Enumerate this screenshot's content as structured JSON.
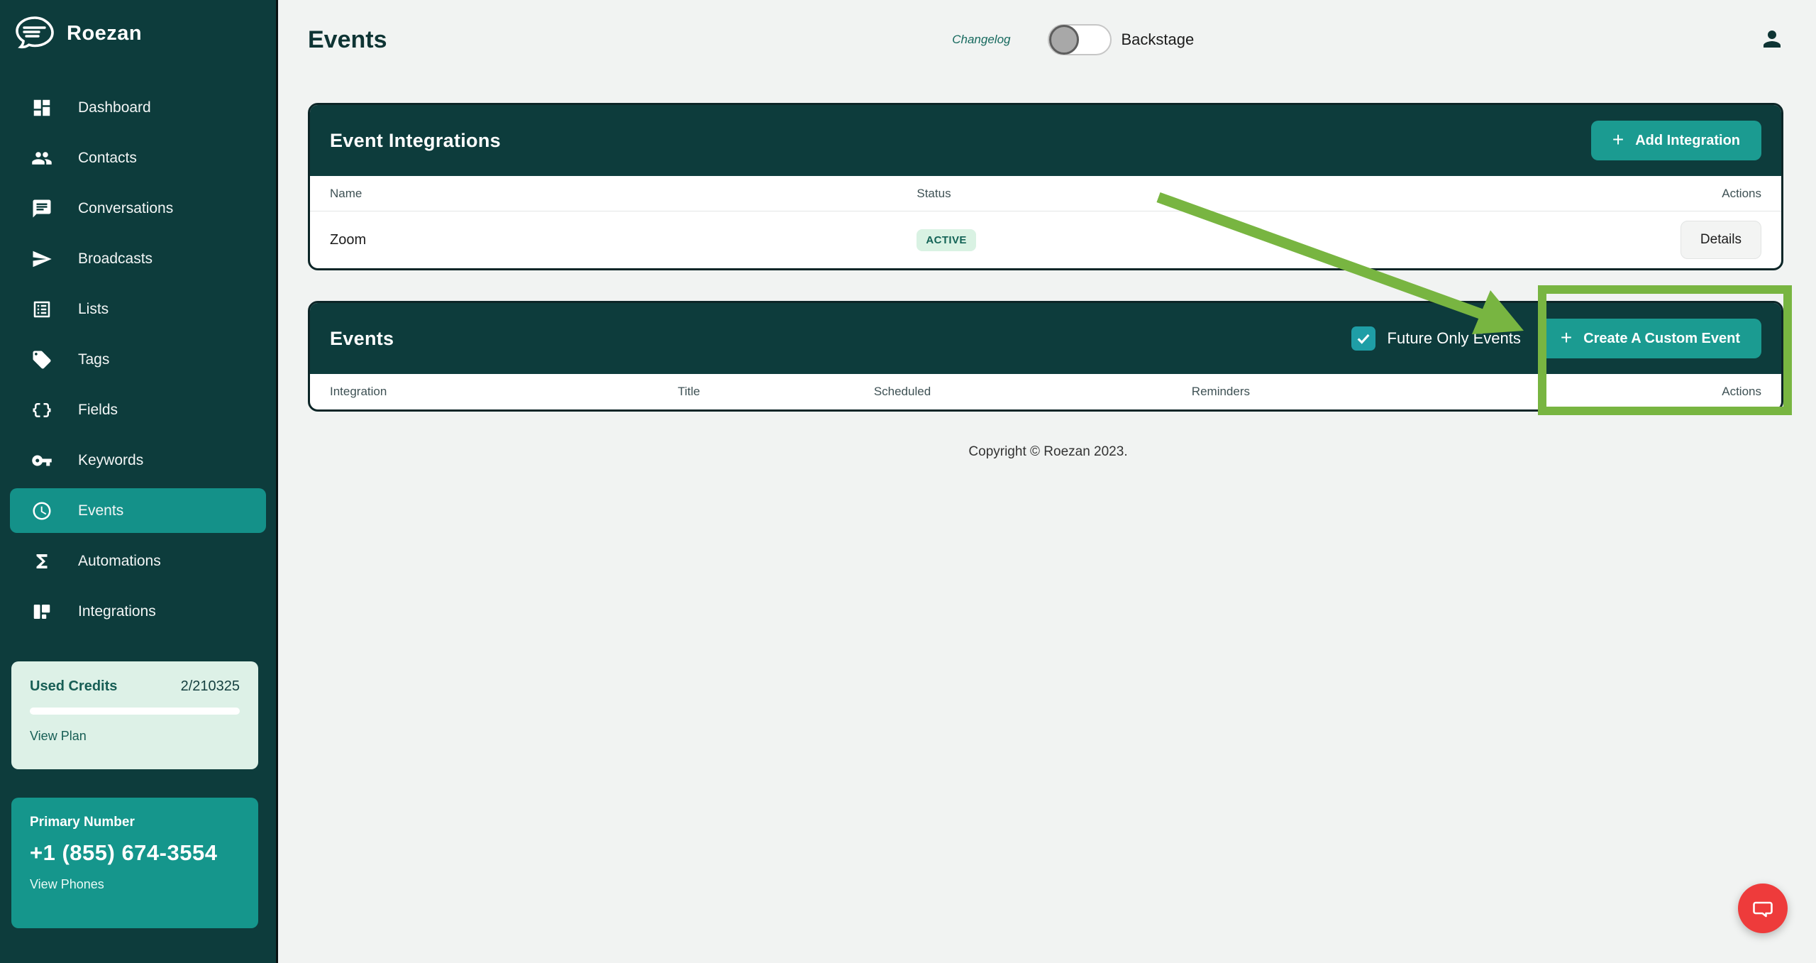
{
  "app": {
    "name": "Roezan"
  },
  "sidebar": {
    "items": [
      {
        "label": "Dashboard",
        "icon": "dashboard-icon",
        "active": false
      },
      {
        "label": "Contacts",
        "icon": "contacts-icon",
        "active": false
      },
      {
        "label": "Conversations",
        "icon": "conversations-icon",
        "active": false
      },
      {
        "label": "Broadcasts",
        "icon": "broadcasts-icon",
        "active": false
      },
      {
        "label": "Lists",
        "icon": "lists-icon",
        "active": false
      },
      {
        "label": "Tags",
        "icon": "tags-icon",
        "active": false
      },
      {
        "label": "Fields",
        "icon": "fields-icon",
        "active": false
      },
      {
        "label": "Keywords",
        "icon": "keywords-icon",
        "active": false
      },
      {
        "label": "Events",
        "icon": "events-clock-icon",
        "active": true
      },
      {
        "label": "Automations",
        "icon": "automations-icon",
        "active": false
      },
      {
        "label": "Integrations",
        "icon": "integrations-icon",
        "active": false
      }
    ],
    "credits": {
      "title": "Used Credits",
      "value": "2/210325",
      "link": "View Plan"
    },
    "phone": {
      "title": "Primary Number",
      "number": "+1 (855) 674-3554",
      "link": "View Phones"
    }
  },
  "header": {
    "title": "Events",
    "changelog_label": "Changelog",
    "toggle_label": "Backstage",
    "toggle_on": false
  },
  "integrations_panel": {
    "title": "Event Integrations",
    "add_button_label": "Add Integration",
    "columns": [
      "Name",
      "Status",
      "Actions"
    ],
    "rows": [
      {
        "name": "Zoom",
        "status": "ACTIVE",
        "action": "Details"
      }
    ]
  },
  "events_panel": {
    "title": "Events",
    "checkbox_label": "Future Only Events",
    "checkbox_checked": true,
    "create_button_label": "Create A Custom Event",
    "columns": [
      "Integration",
      "Title",
      "Scheduled",
      "Reminders",
      "Actions"
    ]
  },
  "footer": {
    "copyright": "Copyright © Roezan 2023."
  },
  "colors": {
    "sidebar_bg": "#0d3c3c",
    "active_nav": "#149189",
    "accent_teal": "#1b9b91",
    "checkbox_teal": "#1f9ea6",
    "credits_card_bg": "#ddf1e7",
    "phone_card_bg": "#15968c",
    "badge_bg": "#d9f2e3",
    "badge_text": "#136356",
    "main_bg": "#f1f3f2",
    "annotation_green": "#78b541",
    "fab_red": "#ee3b3b"
  }
}
